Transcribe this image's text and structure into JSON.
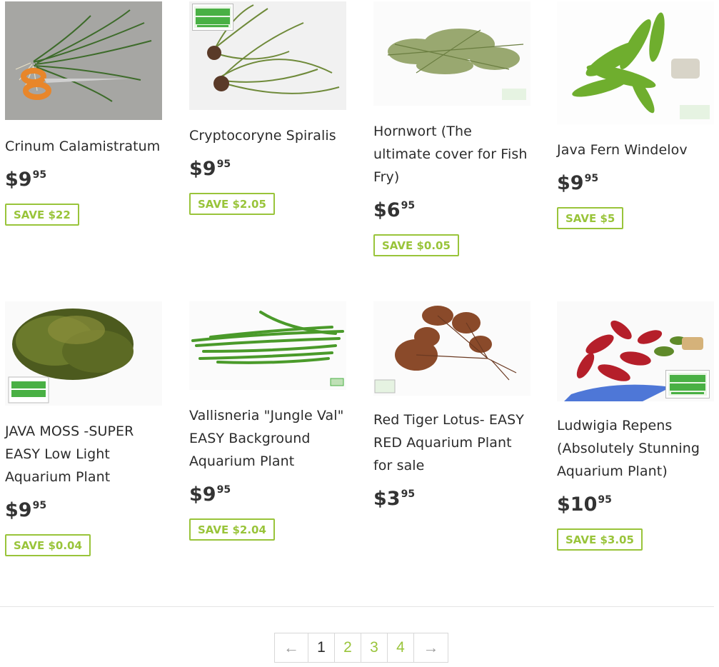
{
  "products": [
    {
      "title": "Crinum Calamistratum",
      "currency": "$",
      "price_main": "9",
      "price_cents": "95",
      "save": "SAVE $22"
    },
    {
      "title": "Cryptocoryne Spiralis",
      "currency": "$",
      "price_main": "9",
      "price_cents": "95",
      "save": "SAVE $2.05",
      "logo_text": "Dustin's fishtanks"
    },
    {
      "title": "Hornwort (The ultimate cover for Fish Fry)",
      "currency": "$",
      "price_main": "6",
      "price_cents": "95",
      "save": "SAVE $0.05"
    },
    {
      "title": "Java Fern Windelov",
      "currency": "$",
      "price_main": "9",
      "price_cents": "95",
      "save": "SAVE $5"
    },
    {
      "title": "JAVA MOSS -SUPER EASY Low Light Aquarium Plant",
      "currency": "$",
      "price_main": "9",
      "price_cents": "95",
      "save": "SAVE $0.04"
    },
    {
      "title": "Vallisneria \"Jungle Val\" EASY Background Aquarium Plant",
      "currency": "$",
      "price_main": "9",
      "price_cents": "95",
      "save": "SAVE $2.04"
    },
    {
      "title": "Red Tiger Lotus- EASY RED Aquarium Plant for sale",
      "currency": "$",
      "price_main": "3",
      "price_cents": "95",
      "save": ""
    },
    {
      "title": "Ludwigia Repens (Absolutely Stunning Aquarium Plant)",
      "currency": "$",
      "price_main": "10",
      "price_cents": "95",
      "save": "SAVE $3.05",
      "logo_text": "Dustin's fishtanks"
    }
  ],
  "pagination": {
    "prev": "←",
    "pages": [
      "1",
      "2",
      "3",
      "4"
    ],
    "current": "1",
    "next": "→"
  },
  "colors": {
    "accent": "#99c43a",
    "text": "#2b2b2b"
  }
}
